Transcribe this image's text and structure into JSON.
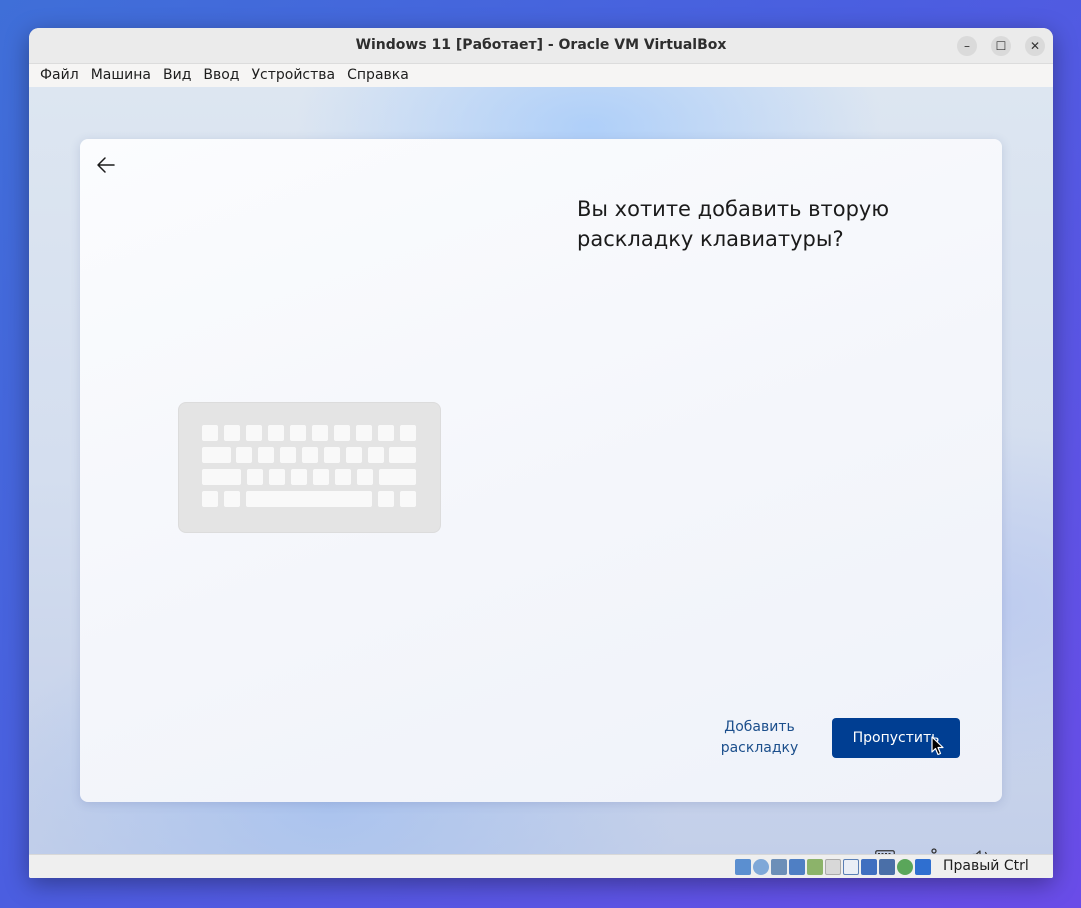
{
  "window": {
    "title": "Windows 11 [Работает] - Oracle VM VirtualBox",
    "minimize_glyph": "–",
    "maximize_glyph": "☐",
    "close_glyph": "✕"
  },
  "menu": [
    {
      "label": "Файл"
    },
    {
      "label": "Машина"
    },
    {
      "label": "Вид"
    },
    {
      "label": "Ввод"
    },
    {
      "label": "Устройства"
    },
    {
      "label": "Справка"
    }
  ],
  "setup": {
    "heading": "Вы хотите добавить вторую раскладку клавиатуры?",
    "add_layout_label": "Добавить раскладку",
    "skip_label": "Пропустить",
    "skip_color": "#003e92",
    "link_color": "#1c4f8c"
  },
  "tray": {
    "icons": [
      "keyboard-icon",
      "accessibility-icon",
      "volume-icon"
    ]
  },
  "statusbar": {
    "icons": [
      "hard-disk-icon",
      "optical-drive-icon",
      "audio-icon",
      "network-icon",
      "usb-icon",
      "shared-folders-icon",
      "display-icon",
      "recording-icon",
      "cpu-icon",
      "guest-additions-icon",
      "mouse-integration-icon"
    ],
    "host_key_label": "Правый Ctrl"
  }
}
